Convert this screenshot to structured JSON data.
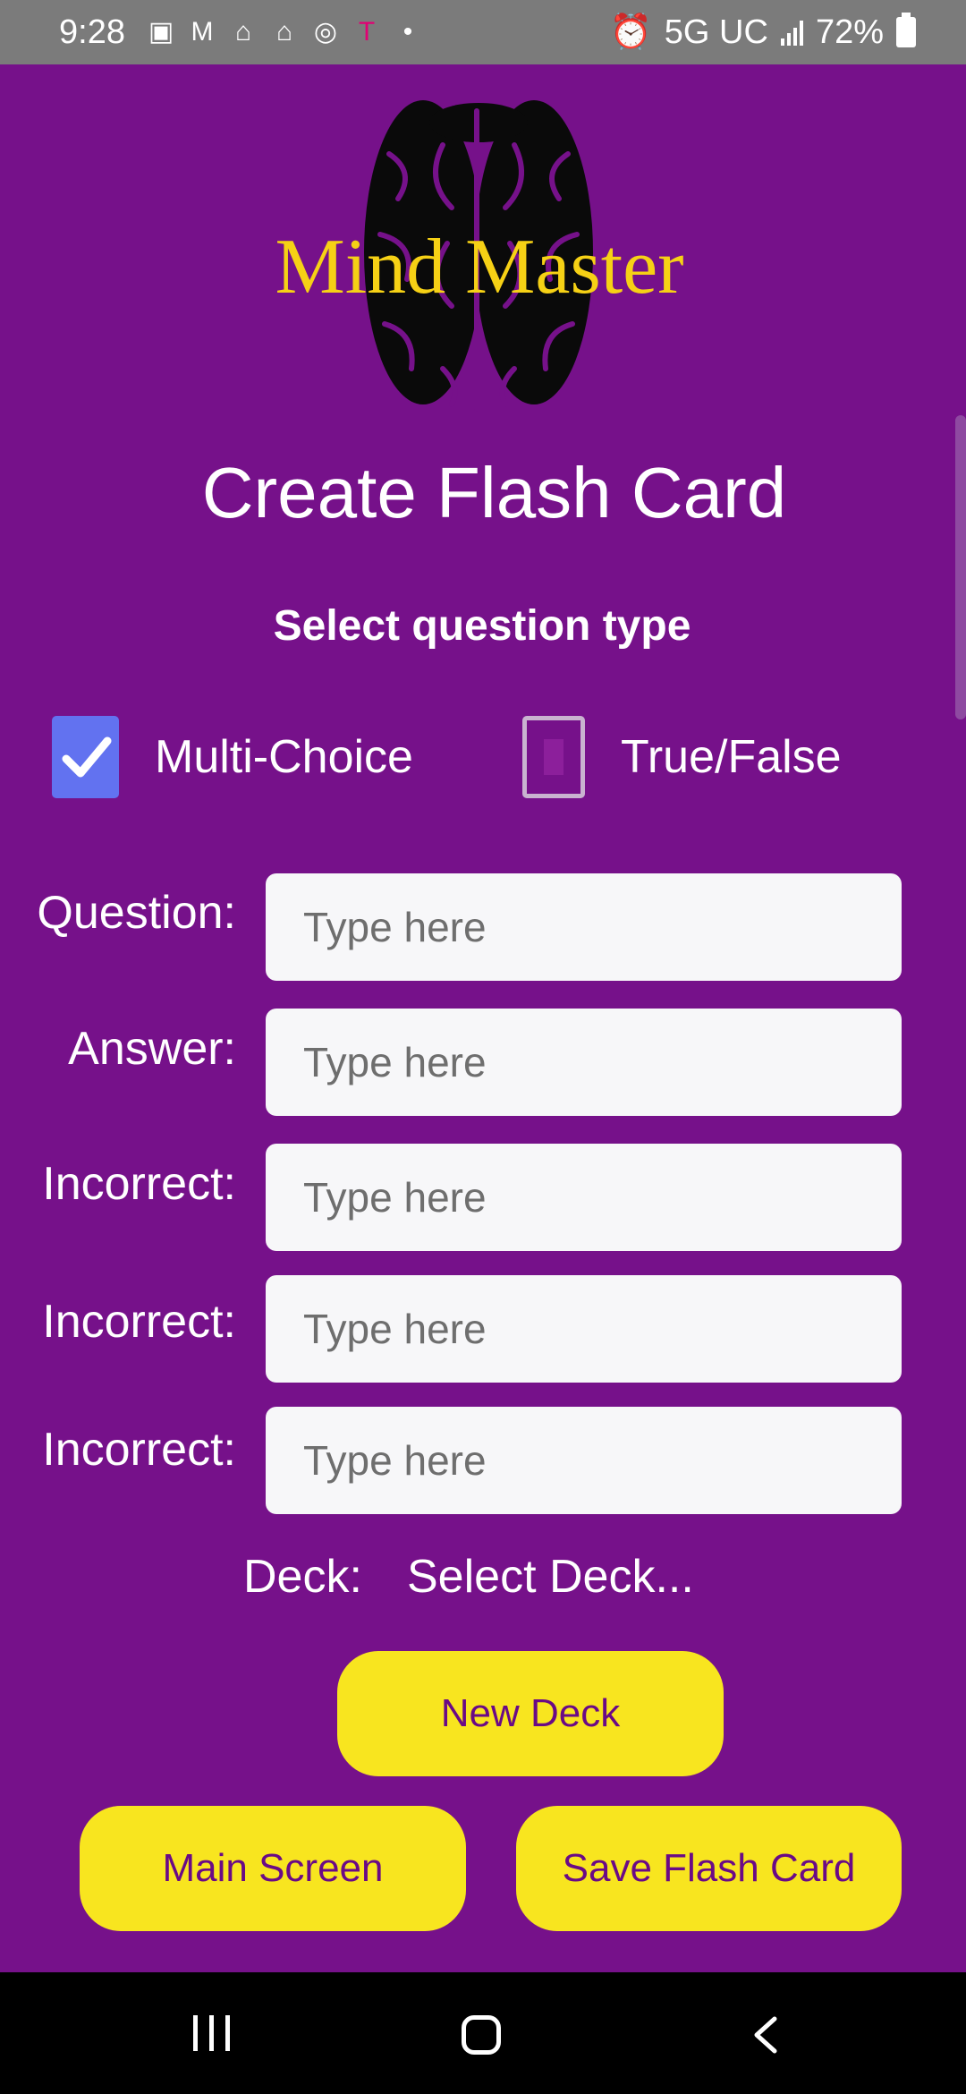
{
  "status_bar": {
    "time": "9:28",
    "network": "5G UC",
    "battery": "72%",
    "notification_icons": [
      "voicemail-icon",
      "gmail-icon",
      "home-icon",
      "home-icon",
      "app-icon",
      "t-mobile-icon",
      "dot-icon"
    ]
  },
  "logo": {
    "text": "Mind Master"
  },
  "page_title": "Create Flash Card",
  "question_type": {
    "label": "Select question type",
    "options": [
      {
        "label": "Multi-Choice",
        "checked": true
      },
      {
        "label": "True/False",
        "checked": false
      }
    ]
  },
  "form": {
    "placeholder": "Type here",
    "fields": [
      {
        "label": "Question:",
        "value": ""
      },
      {
        "label": "Answer:",
        "value": ""
      },
      {
        "label": "Incorrect:",
        "value": ""
      },
      {
        "label": "Incorrect:",
        "value": ""
      },
      {
        "label": "Incorrect:",
        "value": ""
      }
    ],
    "deck_label": "Deck:",
    "deck_value": "Select Deck..."
  },
  "buttons": {
    "new_deck": "New Deck",
    "main_screen": "Main Screen",
    "save_flash_card": "Save Flash Card"
  },
  "colors": {
    "background": "#76118a",
    "accent_yellow": "#f8e51f",
    "logo_gold": "#f6d115",
    "checkbox_blue": "#6272f0"
  }
}
